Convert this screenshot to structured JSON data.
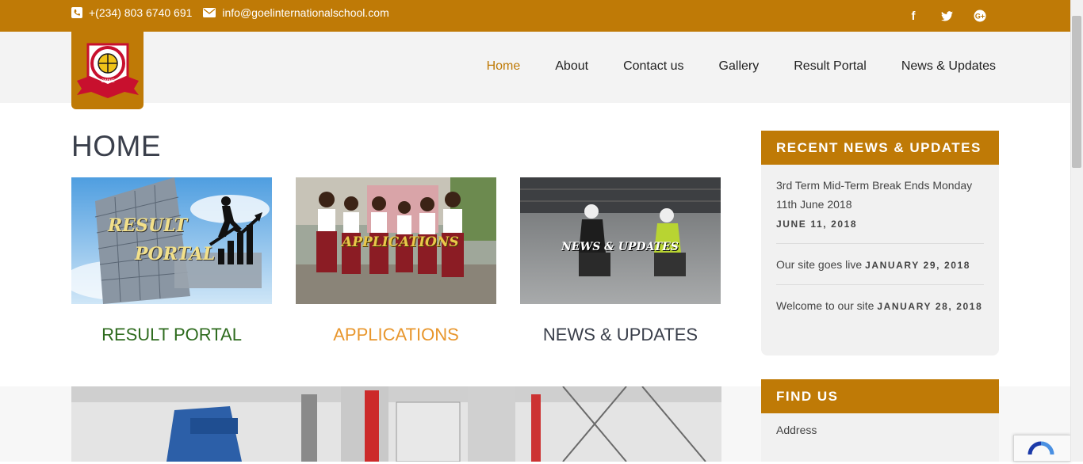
{
  "topbar": {
    "phone": "+(234) 803 6740 691",
    "email": "info@goelinternationalschool.com",
    "social": [
      "facebook-icon",
      "twitter-icon",
      "google-plus-icon"
    ]
  },
  "nav": {
    "items": [
      "Home",
      "About",
      "Contact us",
      "Gallery",
      "Result Portal",
      "News & Updates"
    ]
  },
  "page": {
    "title": "HOME"
  },
  "tiles": [
    {
      "image_text_1": "RESULT",
      "image_text_2": "PORTAL",
      "caption": "RESULT PORTAL",
      "color": "#2e6b1e"
    },
    {
      "image_text_1": "APPLICATIONS",
      "caption": "APPLICATIONS",
      "color": "#e8962c"
    },
    {
      "image_text_1": "NEWS & UPDATES",
      "caption": "NEWS & UPDATES",
      "color": "#3a3f4b"
    }
  ],
  "sidebar": {
    "recent_heading": "RECENT NEWS & UPDATES",
    "news": [
      {
        "title": "3rd Term Mid-Term Break Ends Monday 11th June 2018",
        "date": "JUNE 11, 2018"
      },
      {
        "title": "Our site goes live",
        "date": "JANUARY 29, 2018"
      },
      {
        "title": "Welcome to our site",
        "date": "JANUARY 28, 2018"
      }
    ],
    "find_heading": "FIND US",
    "address_label": "Address"
  },
  "colors": {
    "accent": "#bf7a06"
  }
}
